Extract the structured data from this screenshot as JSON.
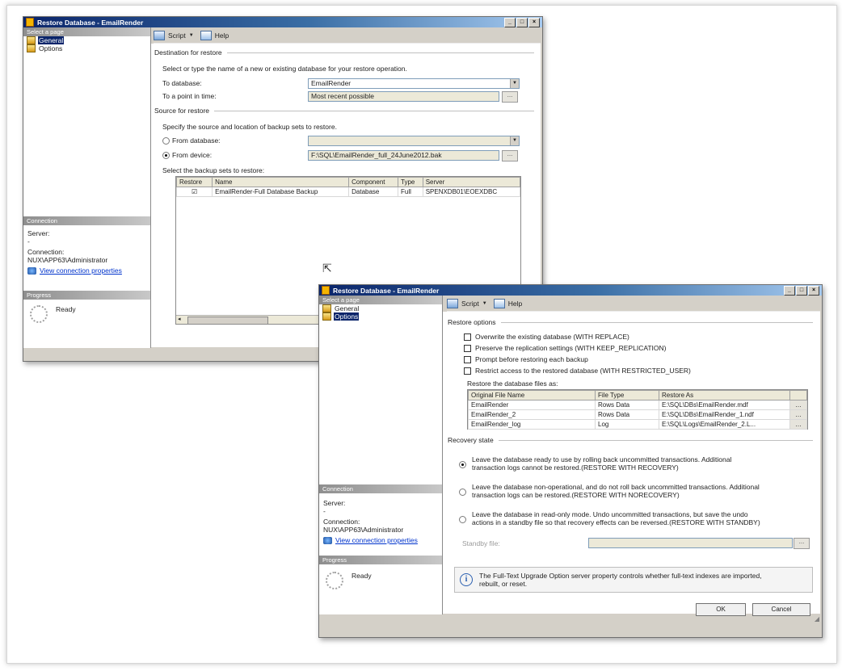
{
  "window1": {
    "title": "Restore Database - EmailRender",
    "left_pane": {
      "select_page_header": "Select a page",
      "pages": [
        {
          "label": "General",
          "selected": true
        },
        {
          "label": "Options",
          "selected": false
        }
      ],
      "connection_header": "Connection",
      "server_label": "Server:",
      "server_value": "-",
      "connection_label": "Connection:",
      "connection_value": "NUX\\APP63\\Administrator",
      "view_connection_link": "View connection properties",
      "progress_header": "Progress",
      "progress_status": "Ready"
    },
    "toolbar": {
      "script_label": "Script",
      "help_label": "Help"
    },
    "destination": {
      "header": "Destination for restore",
      "instruction": "Select or type the name of a new or existing database for your restore operation.",
      "to_database_label": "To database:",
      "to_database_value": "EmailRender",
      "point_in_time_label": "To a point in time:",
      "point_in_time_value": "Most recent possible"
    },
    "source": {
      "header": "Source for restore",
      "instruction": "Specify the source and location of backup sets to restore.",
      "from_database_label": "From database:",
      "from_database_value": "",
      "from_device_label": "From device:",
      "from_device_value": "F:\\SQL\\EmailRender_full_24June2012.bak"
    },
    "backup_sets": {
      "label": "Select the backup sets to restore:",
      "columns": [
        "Restore",
        "Name",
        "Component",
        "Type",
        "Server"
      ],
      "rows": [
        {
          "restore": "☑",
          "name": "EmailRender-Full Database Backup",
          "component": "Database",
          "type": "Full",
          "server": "SPENXDB01\\EOEXDBC"
        }
      ]
    }
  },
  "window2": {
    "title": "Restore Database - EmailRender",
    "left_pane": {
      "select_page_header": "Select a page",
      "pages": [
        {
          "label": "General",
          "selected": false
        },
        {
          "label": "Options",
          "selected": true
        }
      ],
      "connection_header": "Connection",
      "server_label": "Server:",
      "server_value": "-",
      "connection_label": "Connection:",
      "connection_value": "NUX\\APP63\\Administrator",
      "view_connection_link": "View connection properties",
      "progress_header": "Progress",
      "progress_status": "Ready"
    },
    "toolbar": {
      "script_label": "Script",
      "help_label": "Help"
    },
    "restore_options": {
      "header": "Restore options",
      "checkboxes": [
        "Overwrite the existing database (WITH REPLACE)",
        "Preserve the replication settings (WITH KEEP_REPLICATION)",
        "Prompt before restoring each backup",
        "Restrict access to the restored database (WITH RESTRICTED_USER)"
      ],
      "files_label": "Restore the database files as:",
      "columns": [
        "Original File Name",
        "File Type",
        "Restore As"
      ],
      "rows": [
        {
          "original": "EmailRender",
          "type": "Rows Data",
          "restore_as": "E:\\SQL\\DBs\\EmailRender.mdf"
        },
        {
          "original": "EmailRender_2",
          "type": "Rows Data",
          "restore_as": "E:\\SQL\\DBs\\EmailRender_1.ndf"
        },
        {
          "original": "EmailRender_log",
          "type": "Log",
          "restore_as": "E:\\SQL\\Logs\\EmailRender_2.L..."
        }
      ]
    },
    "recovery_state": {
      "header": "Recovery state",
      "options": [
        {
          "line1": "Leave the database ready to use by rolling back uncommitted transactions. Additional",
          "line2": "transaction logs cannot be restored.(RESTORE WITH RECOVERY)",
          "selected": true
        },
        {
          "line1": "Leave the database non-operational, and do not roll back uncommitted transactions. Additional",
          "line2": "transaction logs can be restored.(RESTORE WITH NORECOVERY)",
          "selected": false
        },
        {
          "line1": "Leave the database in read-only mode. Undo uncommitted transactions, but save the undo",
          "line2": "actions in a standby file so that recovery effects can be reversed.(RESTORE WITH STANDBY)",
          "selected": false
        }
      ],
      "standby_label": "Standby file:",
      "standby_value": ""
    },
    "info": {
      "line1": "The Full-Text Upgrade Option server property controls whether full-text indexes are imported,",
      "line2": "rebuilt, or reset."
    },
    "buttons": {
      "ok": "OK",
      "cancel": "Cancel"
    }
  },
  "colors": {
    "title_start": "#0a246a",
    "title_end": "#a6caf0",
    "chrome": "#d4d0c8",
    "link": "#0033cc"
  },
  "icons": [
    "app-icon",
    "page-icon",
    "script-icon",
    "help-icon",
    "connection-icon",
    "spinner-icon",
    "info-icon",
    "mouse-cursor-icon"
  ]
}
